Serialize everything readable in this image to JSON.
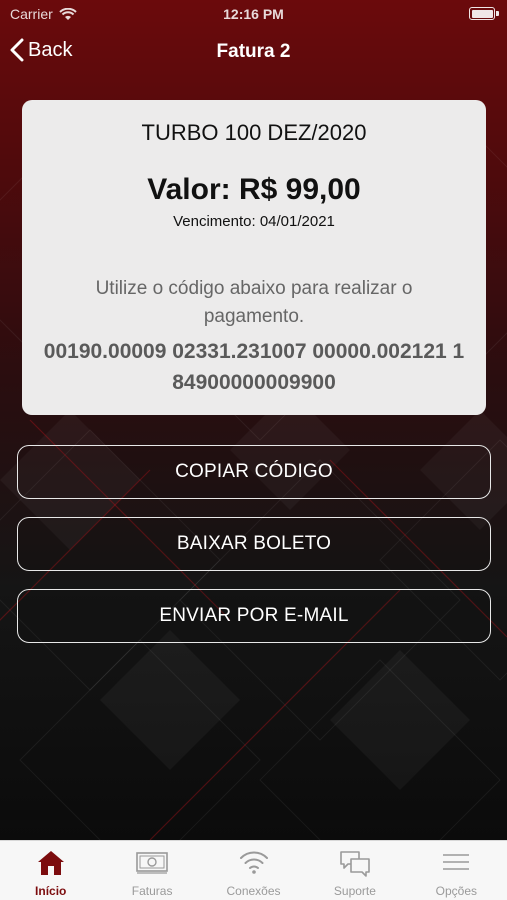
{
  "status_bar": {
    "carrier": "Carrier",
    "time": "12:16 PM"
  },
  "nav": {
    "back_label": "Back",
    "title": "Fatura 2"
  },
  "invoice": {
    "plan": "TURBO 100 DEZ/2020",
    "value": "Valor: R$ 99,00",
    "due": "Vencimento: 04/01/2021",
    "instruction": "Utilize o código abaixo para realizar o pagamento.",
    "barcode": "00190.00009 02331.231007 00000.002121 1 84900000009900"
  },
  "actions": {
    "copy": "COPIAR CÓDIGO",
    "download": "BAIXAR BOLETO",
    "email": "ENVIAR POR E-MAIL"
  },
  "tabs": [
    {
      "label": "Início",
      "icon": "home-icon",
      "active": true
    },
    {
      "label": "Faturas",
      "icon": "money-icon",
      "active": false
    },
    {
      "label": "Conexões",
      "icon": "wifi-icon",
      "active": false
    },
    {
      "label": "Suporte",
      "icon": "chat-icon",
      "active": false
    },
    {
      "label": "Opções",
      "icon": "menu-icon",
      "active": false
    }
  ],
  "colors": {
    "accent": "#7c0c0e",
    "card": "#ecebeb",
    "tab_inactive": "#9a9a9a"
  }
}
